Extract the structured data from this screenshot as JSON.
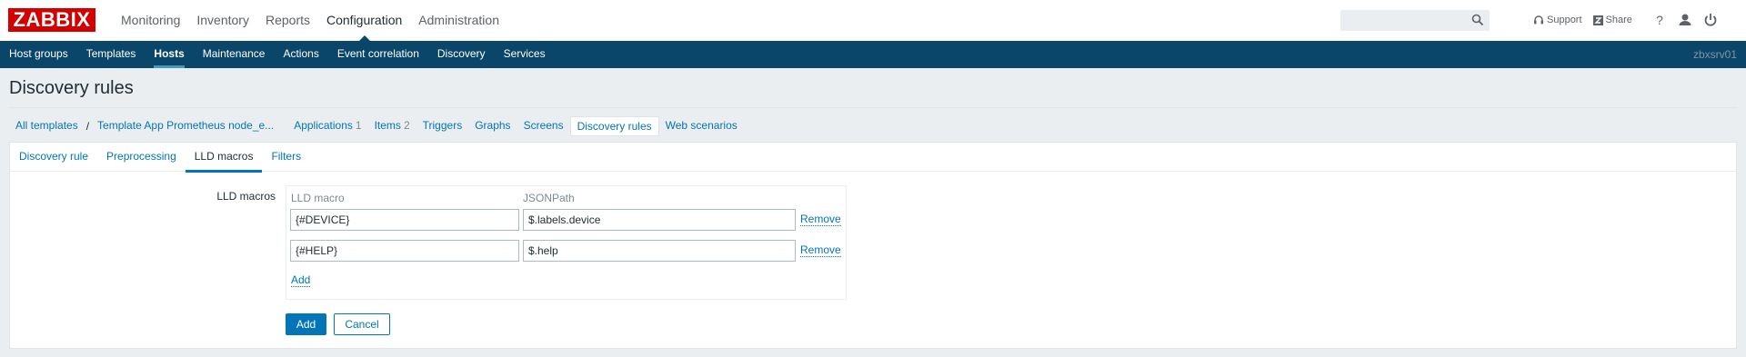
{
  "brand": {
    "logo_text": "ZABBIX",
    "color": "#d40000"
  },
  "top_nav": [
    "Monitoring",
    "Inventory",
    "Reports",
    "Configuration",
    "Administration"
  ],
  "top_nav_active": "Configuration",
  "header_tools": {
    "support": "Support",
    "share": "Share"
  },
  "sub_nav": [
    "Host groups",
    "Templates",
    "Hosts",
    "Maintenance",
    "Actions",
    "Event correlation",
    "Discovery",
    "Services"
  ],
  "sub_nav_active": "Hosts",
  "server_name": "zbxsrv01",
  "page_title": "Discovery rules",
  "breadcrumb": {
    "all_templates": "All templates",
    "separator": "/",
    "template": "Template App Prometheus node_e..."
  },
  "header_tabs": {
    "applications": {
      "label": "Applications",
      "count": "1"
    },
    "items": {
      "label": "Items",
      "count": "2"
    },
    "triggers": "Triggers",
    "graphs": "Graphs",
    "screens": "Screens",
    "discovery_rules": "Discovery rules",
    "web_scenarios": "Web scenarios"
  },
  "form_tabs": [
    "Discovery rule",
    "Preprocessing",
    "LLD macros",
    "Filters"
  ],
  "form_tab_active": "LLD macros",
  "lld": {
    "label": "LLD macros",
    "col_macro": "LLD macro",
    "col_path": "JSONPath",
    "rows": [
      {
        "macro": "{#DEVICE}",
        "path": "$.labels.device",
        "remove": "Remove"
      },
      {
        "macro": "{#HELP}",
        "path": "$.help",
        "remove": "Remove"
      }
    ],
    "add_link": "Add"
  },
  "buttons": {
    "add": "Add",
    "cancel": "Cancel"
  },
  "colors": {
    "nav_bg": "#0a466a",
    "link": "#0275b8",
    "page_bg": "#ebeef0"
  }
}
